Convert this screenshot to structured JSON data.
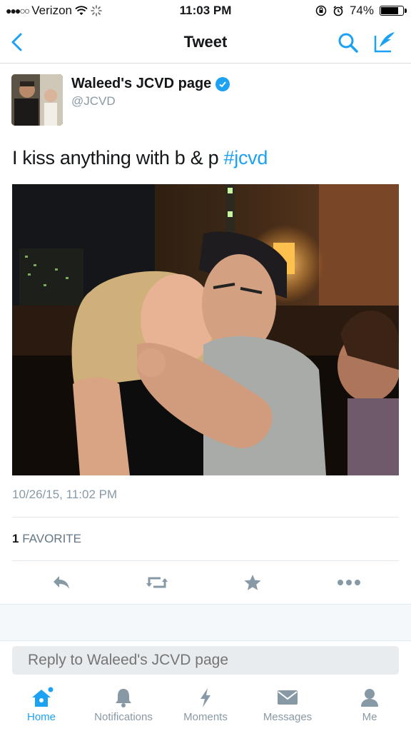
{
  "status_bar": {
    "carrier": "Verizon",
    "time": "11:03 PM",
    "battery": "74%"
  },
  "nav": {
    "title": "Tweet"
  },
  "tweet": {
    "author_name": "Waleed's JCVD page",
    "handle": "@JCVD",
    "text": "I kiss anything with b & p ",
    "hashtag": "#jcvd",
    "timestamp": "10/26/15, 11:02 PM",
    "favorites_count": "1",
    "favorites_label": "FAVORITE"
  },
  "reply": {
    "placeholder": "Reply to Waleed's JCVD page"
  },
  "tabs": [
    {
      "label": "Home",
      "icon": "home-icon",
      "active": true
    },
    {
      "label": "Notifications",
      "icon": "bell-icon",
      "active": false
    },
    {
      "label": "Moments",
      "icon": "lightning-icon",
      "active": false
    },
    {
      "label": "Messages",
      "icon": "envelope-icon",
      "active": false
    },
    {
      "label": "Me",
      "icon": "person-icon",
      "active": false
    }
  ],
  "colors": {
    "accent": "#1da1f2",
    "muted": "#8899a6"
  }
}
